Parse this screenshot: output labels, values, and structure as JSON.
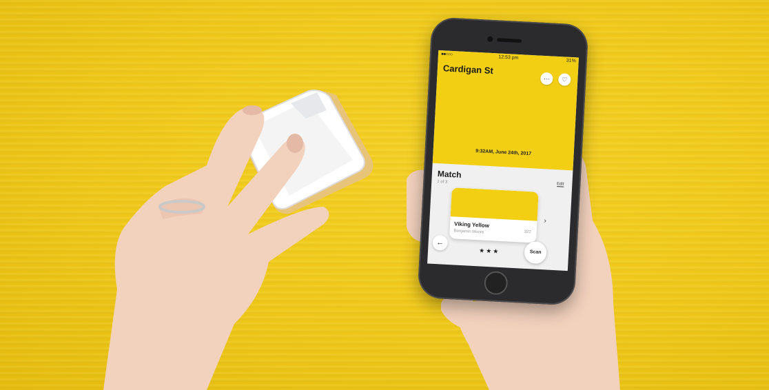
{
  "scene": {
    "background_color": "#f0c91a",
    "skin_color": "#f2d1bd",
    "device_color": "#ffffff",
    "device_wood_color": "#e8c47a"
  },
  "phone": {
    "status": {
      "signal": "●●○○○",
      "time": "12:53 pm",
      "battery": "31%"
    },
    "place_title": "Cardigan St",
    "more_icon": "···",
    "heart_icon": "♡",
    "scan_date": "9:32AM, June 24th, 2017",
    "match_title": "Match",
    "match_count": "1 of 3",
    "edit_label": "Edit",
    "swatch": {
      "color": "#f2cf12",
      "name": "Viking Yellow",
      "brand": "Benjamin Moore",
      "code": "322"
    },
    "next_icon": "›",
    "back_icon": "←",
    "rating": "★★★",
    "scan_label": "Scan"
  }
}
